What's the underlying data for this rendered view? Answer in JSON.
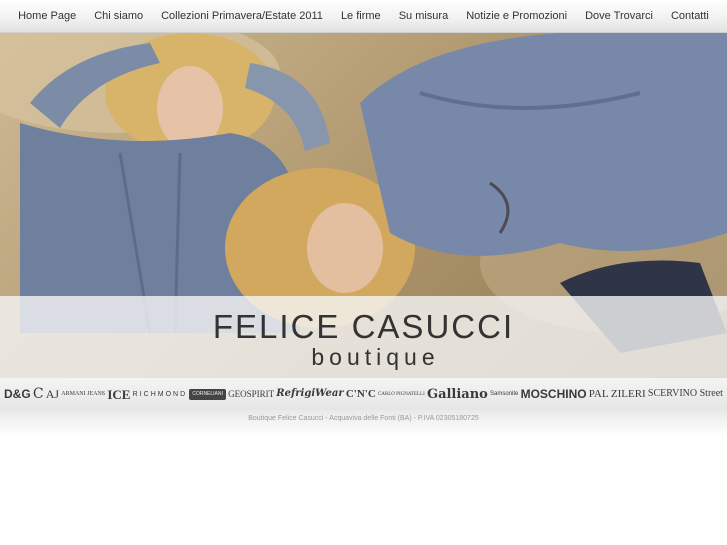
{
  "nav": {
    "items": [
      {
        "label": "Home Page"
      },
      {
        "label": "Chi siamo"
      },
      {
        "label": "Collezioni Primavera/Estate 2011"
      },
      {
        "label": "Le firme"
      },
      {
        "label": "Su misura"
      },
      {
        "label": "Notizie e Promozioni"
      },
      {
        "label": "Dove Trovarci"
      },
      {
        "label": "Contatti"
      }
    ]
  },
  "hero": {
    "brand_name": "FELICE CASUCCI",
    "brand_sub": "boutique"
  },
  "logos": [
    {
      "label": "D&G"
    },
    {
      "label": "C"
    },
    {
      "label": "AJ"
    },
    {
      "label": "ARMANI JEANS"
    },
    {
      "label": "ICE"
    },
    {
      "label": "RICHMOND"
    },
    {
      "label": "CORNELIANI"
    },
    {
      "label": "GEOSPIRIT"
    },
    {
      "label": "RefrigiWear"
    },
    {
      "label": "C'N'C"
    },
    {
      "label": "CARLO PIGNATELLI"
    },
    {
      "label": "Galliano"
    },
    {
      "label": "Samsonite"
    },
    {
      "label": "MOSCHINO"
    },
    {
      "label": "PAL ZILERI"
    },
    {
      "label": "SCERVINO Street"
    }
  ],
  "footer": {
    "text": "Boutique Felice Casucci - Acquaviva delle Fonti (BA) - P.IVA 02305180725"
  },
  "colors": {
    "nav_bg": "#eeeeee",
    "text": "#333333",
    "footer_text": "#9a9a9a"
  }
}
